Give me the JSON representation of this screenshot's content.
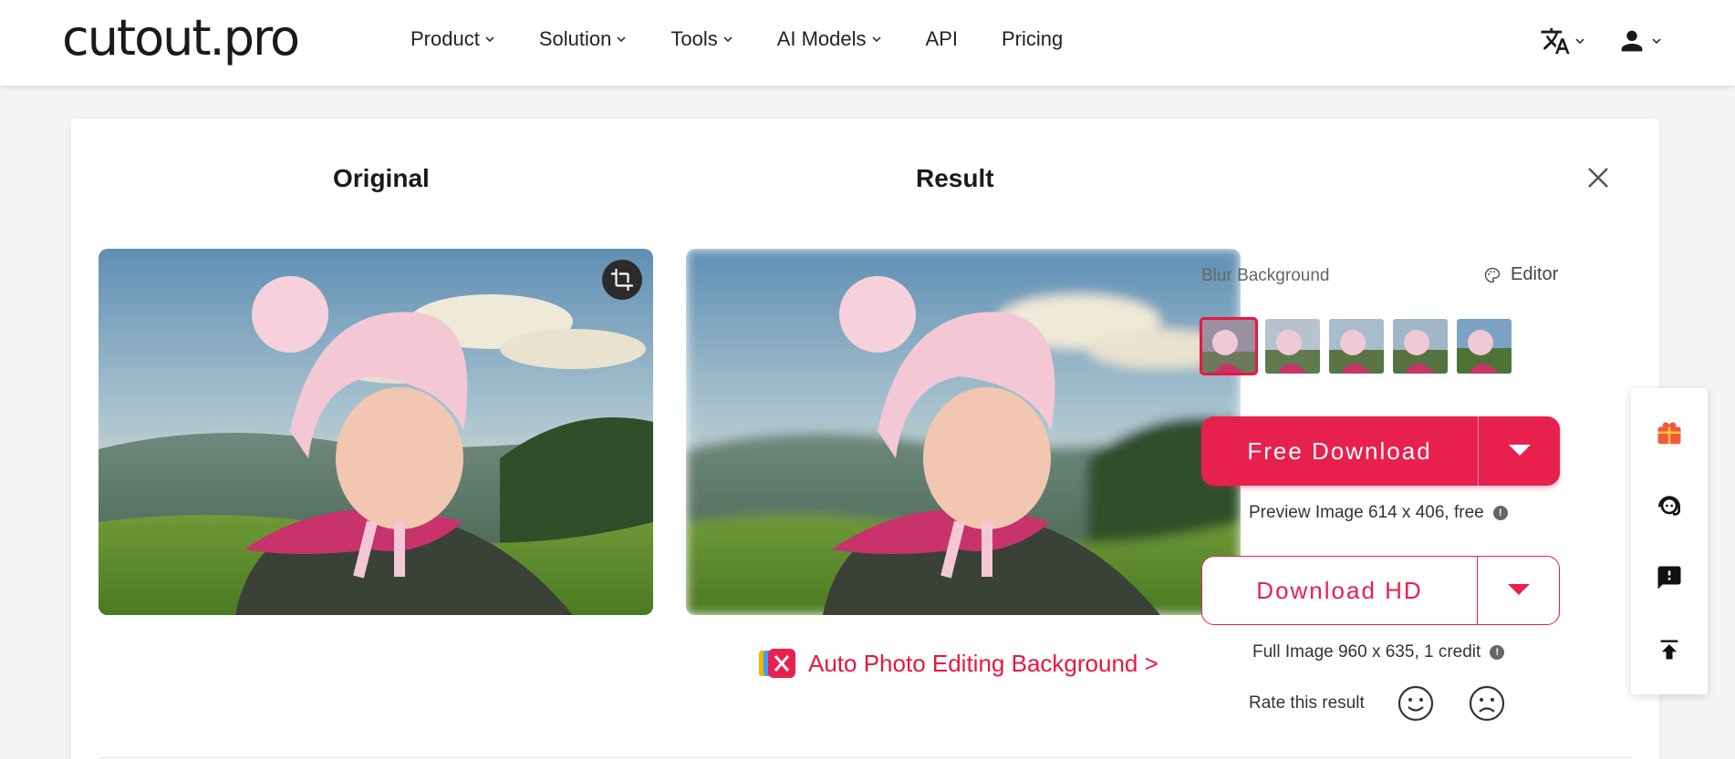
{
  "brand": {
    "logo": "cutout.pro",
    "accent": "#e8204e"
  },
  "nav": {
    "items": [
      {
        "label": "Product",
        "dropdown": true
      },
      {
        "label": "Solution",
        "dropdown": true
      },
      {
        "label": "Tools",
        "dropdown": true
      },
      {
        "label": "AI Models",
        "dropdown": true
      },
      {
        "label": "API",
        "dropdown": false
      },
      {
        "label": "Pricing",
        "dropdown": false
      }
    ]
  },
  "header_icons": {
    "language": "translate-icon",
    "account": "user-icon"
  },
  "result_panel": {
    "original_title": "Original",
    "result_title": "Result",
    "auto_link": "Auto Photo Editing Background >"
  },
  "side": {
    "effect_title": "Blur Background",
    "editor_label": "Editor",
    "thumbnails_count": 5,
    "selected_thumbnail": 0,
    "free_download_label": "Free Download",
    "preview_info": "Preview Image 614 x 406, free",
    "download_hd_label": "Download HD",
    "full_info": "Full Image 960 x 635, 1 credit",
    "rate_label": "Rate this result"
  },
  "floatbar": [
    "gift-icon",
    "support-agent-icon",
    "feedback-icon",
    "back-to-top-icon"
  ]
}
